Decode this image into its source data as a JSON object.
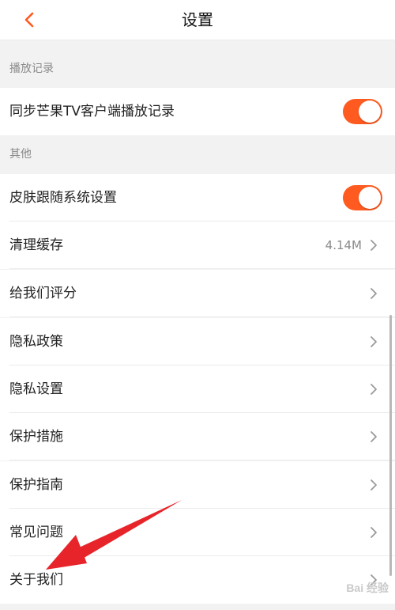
{
  "header": {
    "title": "设置"
  },
  "sections": {
    "playback": {
      "title": "播放记录",
      "items": [
        {
          "label": "同步芒果TV客户端播放记录",
          "toggle_on": true
        }
      ]
    },
    "other": {
      "title": "其他",
      "items": [
        {
          "label": "皮肤跟随系统设置",
          "toggle_on": true
        },
        {
          "label": "清理缓存",
          "value": "4.14M"
        },
        {
          "label": "给我们评分"
        },
        {
          "label": "隐私政策"
        },
        {
          "label": "隐私设置"
        },
        {
          "label": "保护措施"
        },
        {
          "label": "保护指南"
        },
        {
          "label": "常见问题"
        },
        {
          "label": "关于我们"
        }
      ]
    }
  },
  "watermark": "Bai 经验",
  "colors": {
    "accent": "#ff5a1f",
    "annotation_arrow": "#e8242b"
  }
}
